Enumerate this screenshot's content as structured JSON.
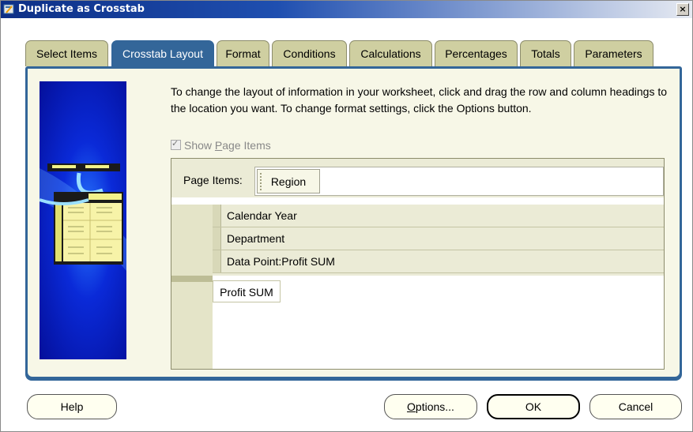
{
  "window": {
    "title": "Duplicate as Crosstab",
    "close_label": "×"
  },
  "tabs": [
    {
      "label": "Select Items",
      "active": false
    },
    {
      "label": "Crosstab Layout",
      "active": true
    },
    {
      "label": "Format",
      "active": false
    },
    {
      "label": "Conditions",
      "active": false
    },
    {
      "label": "Calculations",
      "active": false
    },
    {
      "label": "Percentages",
      "active": false
    },
    {
      "label": "Totals",
      "active": false
    },
    {
      "label": "Parameters",
      "active": false
    }
  ],
  "content": {
    "instructions": "To change the layout of information in your worksheet, click and drag the row and column headings to the location you want.  To change format settings, click the Options button.",
    "show_page_items": {
      "pre": "Show ",
      "underlined": "P",
      "post": "age Items",
      "checked": true,
      "enabled": false
    }
  },
  "layout": {
    "page_items_label": "Page Items:",
    "page_items": [
      "Region"
    ],
    "row_headings": [
      "Calendar Year",
      "Department",
      "Data Point:Profit SUM"
    ],
    "data_items": [
      "Profit SUM"
    ]
  },
  "buttons": {
    "help": "Help",
    "options_pre": "",
    "options_underlined": "O",
    "options_post": "ptions...",
    "ok": "OK",
    "cancel": "Cancel"
  },
  "colors": {
    "accent": "#336699",
    "tab_inactive": "#cfcfa1",
    "panel_bg": "#f7f7e7",
    "title_start": "#0d2f86"
  }
}
